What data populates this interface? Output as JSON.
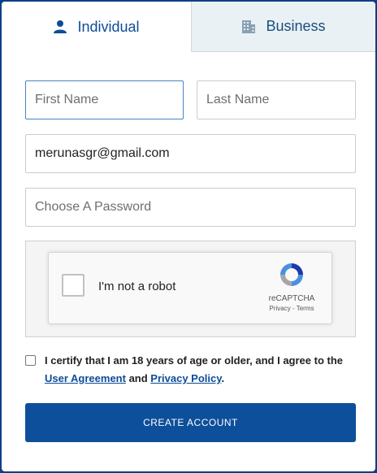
{
  "tabs": {
    "individual_label": "Individual",
    "business_label": "Business",
    "individual_icon": "person-icon",
    "business_icon": "building-icon"
  },
  "form": {
    "first_name_placeholder": "First Name",
    "last_name_placeholder": "Last Name",
    "email_value": "merunasgr@gmail.com",
    "password_placeholder": "Choose A Password"
  },
  "captcha": {
    "label": "I'm not a robot",
    "brand": "reCAPTCHA",
    "links": "Privacy - Terms",
    "icon": "recaptcha-logo-icon"
  },
  "certify": {
    "text_before": "I certify that I am 18 years of age or older, and I agree to the ",
    "user_agreement": "User Agreement",
    "and": " and ",
    "privacy_policy": "Privacy Policy",
    "end": "."
  },
  "submit_label": "CREATE ACCOUNT",
  "colors": {
    "brand_blue": "#0d4f9a",
    "frame_blue": "#0d3f86",
    "inactive_tab": "#e9f1f5"
  }
}
